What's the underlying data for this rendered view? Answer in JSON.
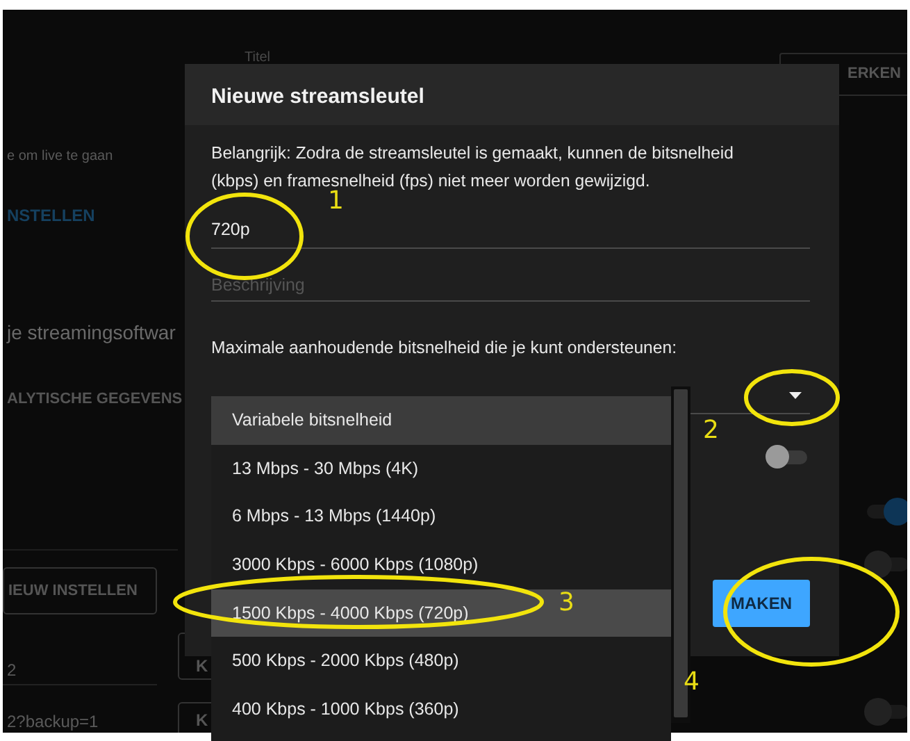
{
  "background": {
    "title_label": "Titel",
    "edit_button": "ERKEN",
    "live_hint": "e om live te gaan",
    "setup_link": "NSTELLEN",
    "software_heading": "je streamingsoftwar",
    "analytics_heading": "ALYTISCHE GEGEVENS",
    "reset_button": "IEUW INSTELLEN",
    "url_1": "2",
    "url_2": "2?backup=1",
    "copy_buttons": [
      "K",
      "K"
    ],
    "toggles": [
      {
        "on": true
      },
      {
        "on": false
      },
      {
        "on": false
      }
    ]
  },
  "dialog": {
    "title": "Nieuwe streamsleutel",
    "notice": "Belangrijk: Zodra de streamsleutel is gemaakt, kunnen de bitsnelheid (kbps) en framesnelheid (fps) niet meer worden gewijzigd.",
    "name_field": {
      "value": "720p"
    },
    "description_field": {
      "placeholder": "Beschrijving"
    },
    "bitrate_label": "Maximale aanhoudende bitsnelheid die je kunt ondersteunen:",
    "bitrate_dropdown": {
      "expanded": true,
      "options": [
        {
          "label": "Variabele bitsnelheid",
          "selected": false,
          "focused": true
        },
        {
          "label": "13 Mbps - 30 Mbps (4K)",
          "selected": false,
          "focused": false
        },
        {
          "label": "6 Mbps - 13 Mbps (1440p)",
          "selected": false,
          "focused": false
        },
        {
          "label": "3000 Kbps - 6000 Kbps (1080p)",
          "selected": false,
          "focused": false
        },
        {
          "label": "1500 Kbps - 4000 Kbps (720p)",
          "selected": true,
          "focused": false
        },
        {
          "label": "500 Kbps - 2000 Kbps (480p)",
          "selected": false,
          "focused": false
        },
        {
          "label": "400 Kbps - 1000 Kbps (360p)",
          "selected": false,
          "focused": false
        }
      ]
    },
    "toggle": {
      "on": false
    },
    "create_button": "MAKEN"
  },
  "annotations": [
    {
      "label": "1"
    },
    {
      "label": "2"
    },
    {
      "label": "3"
    },
    {
      "label": "4"
    }
  ]
}
